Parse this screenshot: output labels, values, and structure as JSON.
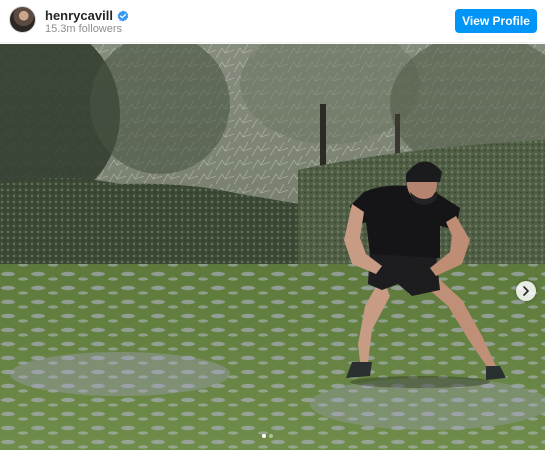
{
  "profile": {
    "username": "henrycavill",
    "followers": "15.3m followers",
    "verified": true,
    "view_profile_label": "View Profile"
  },
  "icons": {
    "verified": "verified-badge-icon",
    "next": "chevron-right-icon"
  },
  "carousel": {
    "slide_count": 2,
    "active_index": 0
  },
  "colors": {
    "accent": "#0095f6",
    "text_primary": "#262626",
    "text_secondary": "#8e8e8e"
  }
}
